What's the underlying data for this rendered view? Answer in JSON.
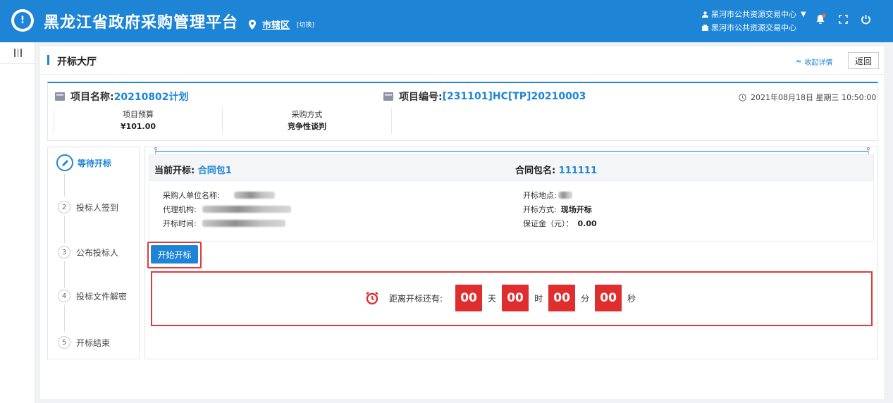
{
  "header": {
    "logo_glyph": "!",
    "title": "黑龙江省政府采购管理平台",
    "region": "市辖区",
    "switch_label": "[切换]",
    "user_org_top": "黑河市公共资源交易中心",
    "user_org_bottom": "黑河市公共资源交易中心",
    "icons": [
      "bell-icon",
      "fullscreen-icon",
      "power-icon"
    ]
  },
  "page": {
    "title": "开标大厅",
    "collapse_label": "收起详情",
    "back_label": "返回"
  },
  "project": {
    "name_label": "项目名称:",
    "name_value": "20210802计划",
    "code_label": "项目编号:",
    "code_value": "[231101]HC[TP]20210003",
    "datetime": "2021年08月18日 星期三 10:50:00",
    "stats": [
      {
        "label": "项目预算",
        "value": "¥101.00"
      },
      {
        "label": "采购方式",
        "value": "竞争性谈判"
      }
    ]
  },
  "steps": [
    {
      "num": "",
      "label": "等待开标",
      "active": true
    },
    {
      "num": "2",
      "label": "投标人签到",
      "active": false
    },
    {
      "num": "3",
      "label": "公布投标人",
      "active": false
    },
    {
      "num": "4",
      "label": "投标文件解密",
      "active": false
    },
    {
      "num": "5",
      "label": "开标结束",
      "active": false
    }
  ],
  "current": {
    "label": "当前开标:",
    "value": "合同包1",
    "pkg_label": "合同包名:",
    "pkg_value": "111111"
  },
  "details": {
    "buyer_label": "采购人单位名称:",
    "agency_label": "代理机构:",
    "time_label": "开标时间:",
    "place_label": "开标地点:",
    "mode_label": "开标方式:",
    "mode_value": "现场开标",
    "deposit_label": "保证金（元）：",
    "deposit_value": "0.00"
  },
  "start_button": "开始开标",
  "countdown": {
    "label": "距离开标还有:",
    "days": "00",
    "days_unit": "天",
    "hours": "00",
    "hours_unit": "时",
    "minutes": "00",
    "minutes_unit": "分",
    "seconds": "00",
    "seconds_unit": "秒"
  },
  "colors": {
    "brand": "#1e84d6",
    "alert": "#e02d2d"
  }
}
